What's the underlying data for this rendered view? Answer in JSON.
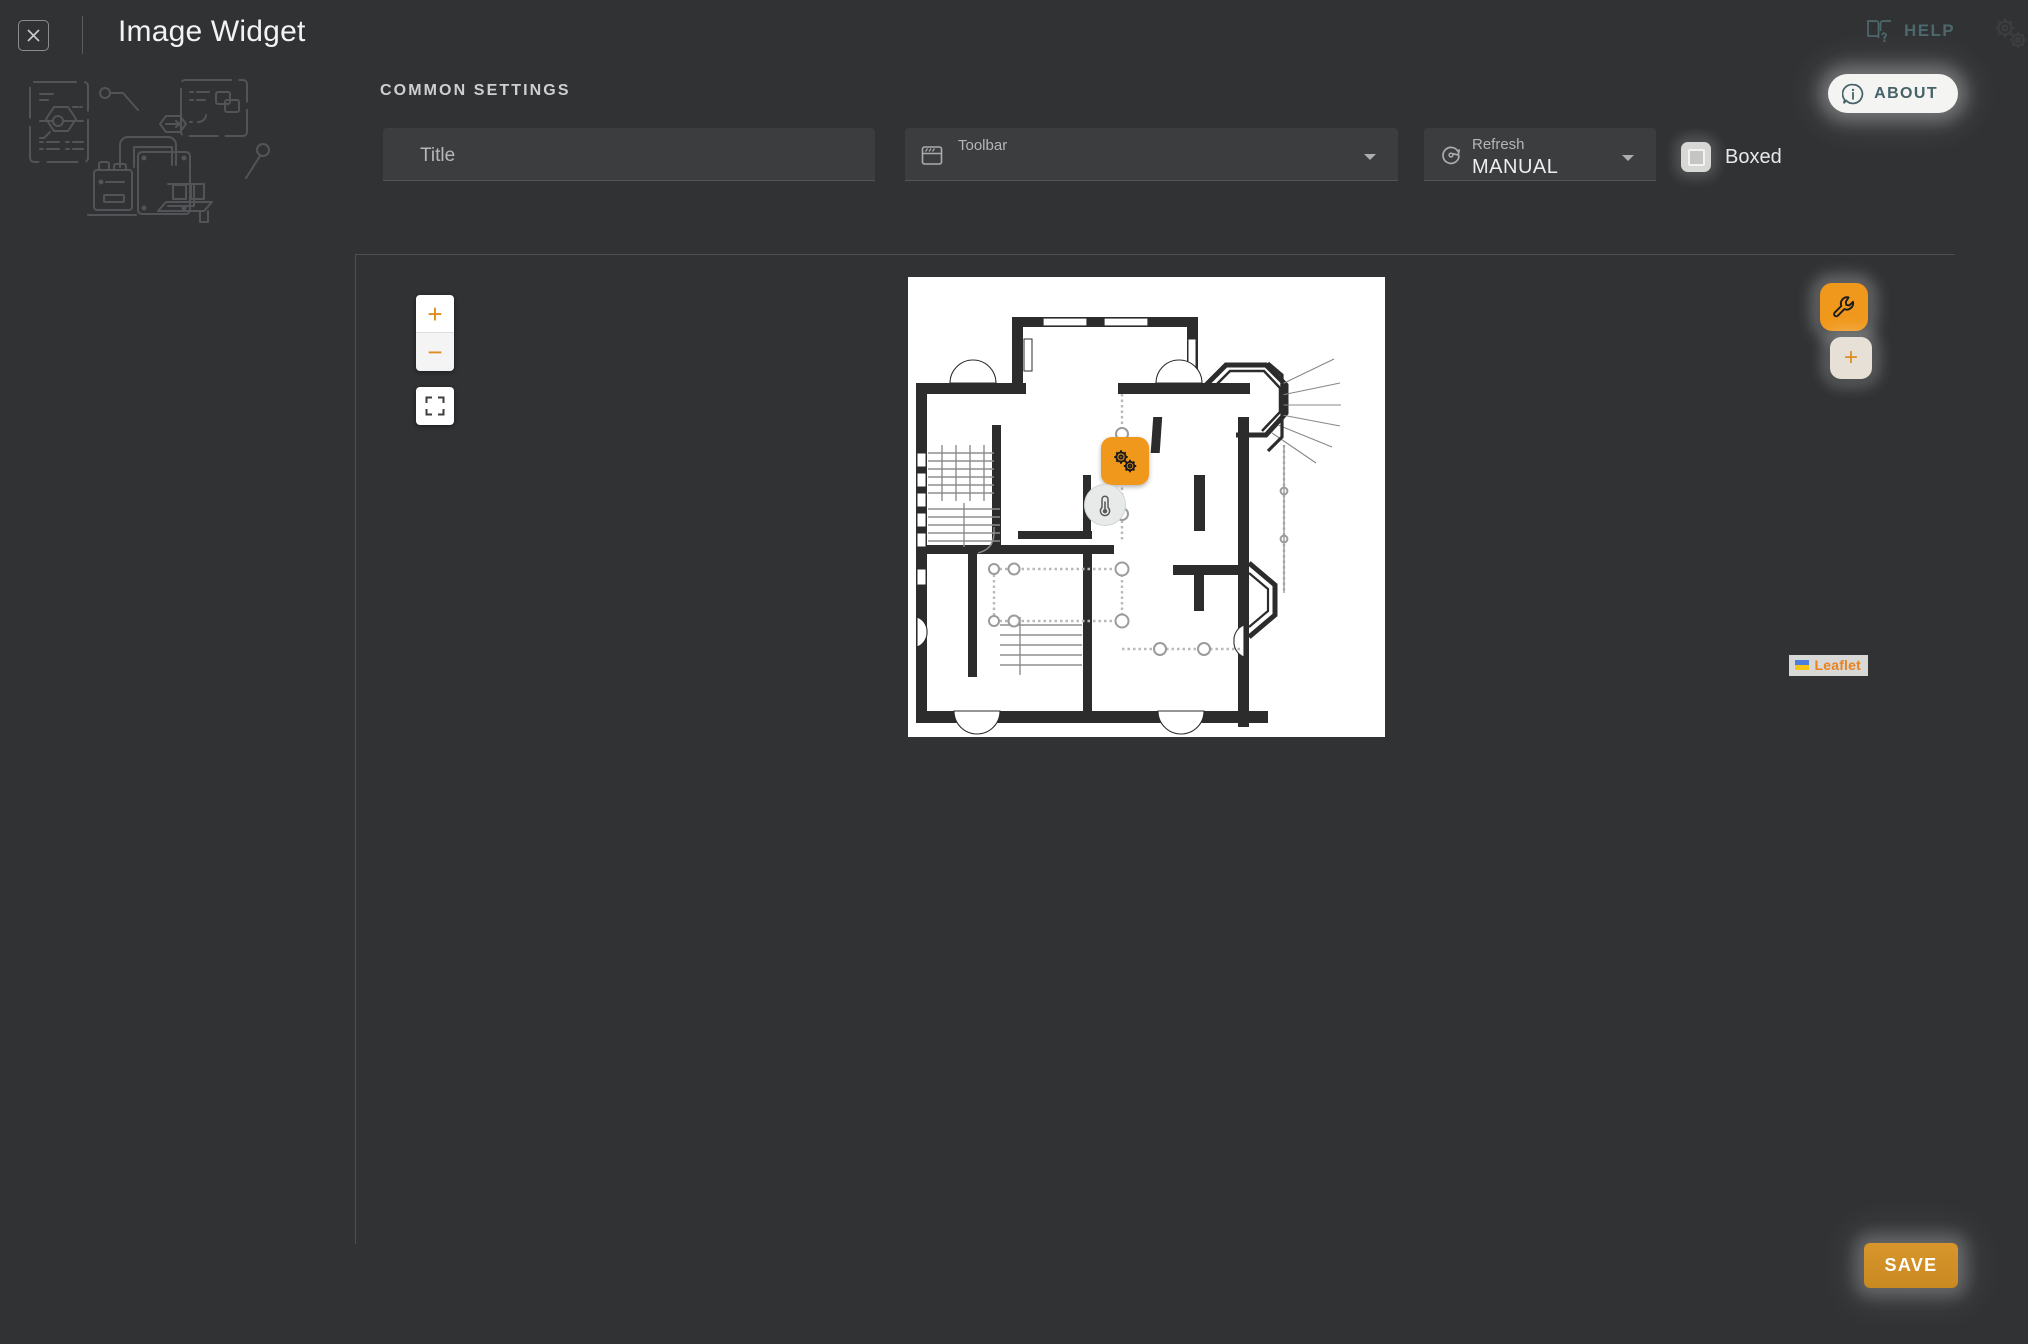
{
  "header": {
    "close_icon": "close-icon",
    "title": "Image Widget",
    "help_label": "HELP",
    "help_icon": "book-question-icon",
    "gears_icon": "gears-icon",
    "about_label": "ABOUT",
    "about_icon": "info-circle-icon"
  },
  "sidebar": {
    "illustration": "iot-devices-line-art"
  },
  "common_settings": {
    "section_label": "COMMON SETTINGS",
    "title_field": {
      "placeholder": "Title",
      "value": ""
    },
    "toolbar_field": {
      "label": "Toolbar",
      "value": "",
      "icon": "toolbar-icon",
      "chevron": "chevron-down-icon"
    },
    "refresh_field": {
      "label": "Refresh",
      "value": "MANUAL",
      "icon": "refresh-icon",
      "chevron": "chevron-down-icon"
    },
    "boxed_checkbox": {
      "label": "Boxed",
      "checked": false
    }
  },
  "preview": {
    "map": {
      "zoom_in_label": "+",
      "zoom_out_label": "−",
      "fullscreen_icon": "fullscreen-icon",
      "attribution": "Leaflet",
      "flag_icon": "ukraine-flag-icon",
      "markers": [
        {
          "name": "gears-marker",
          "icon": "gears-icon",
          "color": "#f0981c",
          "shape": "rounded-square"
        },
        {
          "name": "thermometer-marker",
          "icon": "thermometer-icon",
          "color": "#e8eaea",
          "shape": "circle"
        }
      ],
      "background": "floor-plan-image"
    },
    "fab_edit": {
      "icon": "wrench-icon",
      "color": "#f0981c"
    },
    "fab_add": {
      "icon": "plus-icon",
      "label": "+",
      "color": "#e7e0d6"
    }
  },
  "footer": {
    "save_label": "SAVE"
  },
  "colors": {
    "background": "#303234",
    "accent_orange": "#f0981c",
    "save_orange": "#d8962b",
    "teal_text": "#4d686c",
    "field_bg": "#3b3d3f"
  }
}
